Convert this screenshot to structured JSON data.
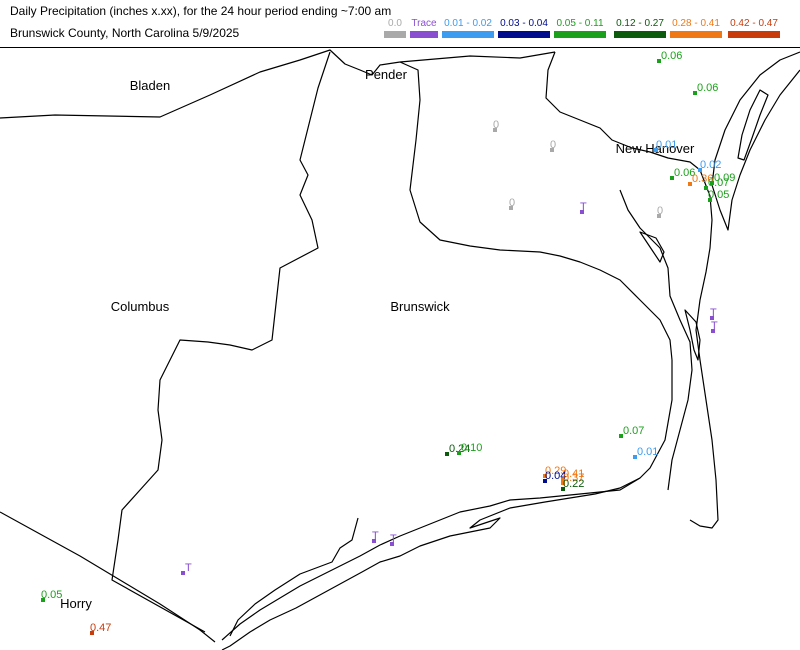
{
  "header": {
    "title_line1": "Daily Precipitation (inches  x.xx),  for the 24 hour period ending ~7:00 am",
    "title_line2": "Brunswick County, North Carolina  5/9/2025"
  },
  "legend": [
    {
      "label": "0.0",
      "color": "#a9a9a9"
    },
    {
      "label": "Trace",
      "color": "#8a4fd1"
    },
    {
      "label": "0.01 - 0.02",
      "color": "#3c9cf0"
    },
    {
      "label": "0.03 - 0.04",
      "color": "#000c8c"
    },
    {
      "label": "0.05 - 0.11",
      "color": "#1ba01b"
    },
    {
      "label": "0.12 - 0.27",
      "color": "#0c5a0c"
    },
    {
      "label": "0.28 - 0.41",
      "color": "#f07814"
    },
    {
      "label": "0.42 - 0.47",
      "color": "#c83c0c"
    }
  ],
  "counties": [
    {
      "name": "Bladen"
    },
    {
      "name": "Pender"
    },
    {
      "name": "New Hanover"
    },
    {
      "name": "Columbus"
    },
    {
      "name": "Brunswick"
    },
    {
      "name": "Horry"
    }
  ],
  "stations": [
    {
      "label": "0.06",
      "color": "#1ba01b"
    },
    {
      "label": "0.06",
      "color": "#1ba01b"
    },
    {
      "label": "0",
      "color": "#a9a9a9"
    },
    {
      "label": "0",
      "color": "#a9a9a9"
    },
    {
      "label": "0.01",
      "color": "#3c9cf0"
    },
    {
      "label": "T",
      "color": "#8a4fd1"
    },
    {
      "label": "0.02",
      "color": "#3c9cf0"
    },
    {
      "label": "0.06",
      "color": "#1ba01b"
    },
    {
      "label": "0.36",
      "color": "#f07814"
    },
    {
      "label": "0.07",
      "color": "#1ba01b"
    },
    {
      "label": "0.09",
      "color": "#1ba01b"
    },
    {
      "label": "0.05",
      "color": "#1ba01b"
    },
    {
      "label": "0",
      "color": "#a9a9a9"
    },
    {
      "label": "T",
      "color": "#8a4fd1"
    },
    {
      "label": "0",
      "color": "#a9a9a9"
    },
    {
      "label": "T",
      "color": "#8a4fd1"
    },
    {
      "label": "T",
      "color": "#8a4fd1"
    },
    {
      "label": "0.07",
      "color": "#1ba01b"
    },
    {
      "label": "0.01",
      "color": "#3c9cf0"
    },
    {
      "label": "0.24",
      "color": "#0c5a0c"
    },
    {
      "label": "0.10",
      "color": "#1ba01b"
    },
    {
      "label": "0.29",
      "color": "#f07814"
    },
    {
      "label": "0.41",
      "color": "#f07814"
    },
    {
      "label": "0.04",
      "color": "#000c8c"
    },
    {
      "label": "0.37",
      "color": "#f07814"
    },
    {
      "label": "0.22",
      "color": "#0c5a0c"
    },
    {
      "label": "T",
      "color": "#8a4fd1"
    },
    {
      "label": "T",
      "color": "#8a4fd1"
    },
    {
      "label": "0.05",
      "color": "#1ba01b"
    },
    {
      "label": "0.47",
      "color": "#c83c0c"
    },
    {
      "label": "0",
      "color": "#a9a9a9"
    }
  ]
}
